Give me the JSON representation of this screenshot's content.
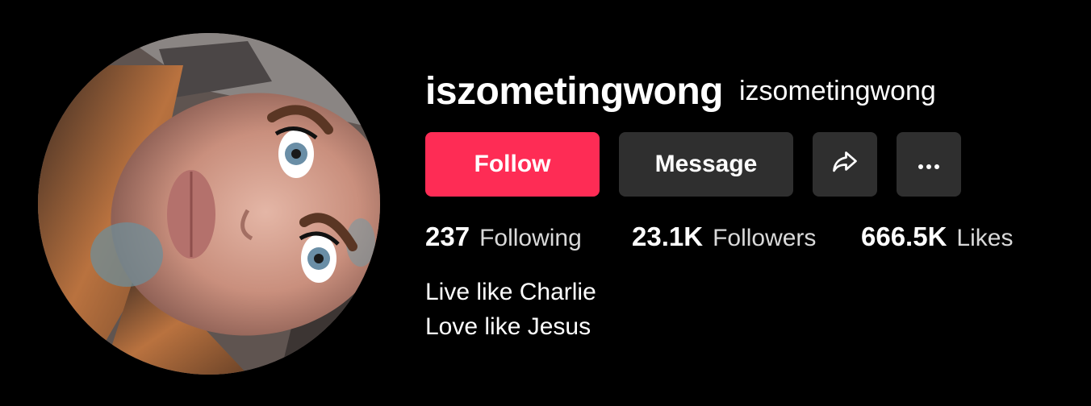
{
  "profile": {
    "username": "iszometingwong",
    "nickname": "izsometingwong",
    "avatar_alt": "profile-photo"
  },
  "actions": {
    "follow_label": "Follow",
    "message_label": "Message",
    "share_icon": "share-arrow-icon",
    "more_icon": "more-dots-icon",
    "more_glyph": "···"
  },
  "stats": {
    "following": {
      "count": "237",
      "label": "Following"
    },
    "followers": {
      "count": "23.1K",
      "label": "Followers"
    },
    "likes": {
      "count": "666.5K",
      "label": "Likes"
    }
  },
  "bio": {
    "line1": "Live like Charlie",
    "line2": "Love like Jesus"
  },
  "colors": {
    "background": "#000000",
    "follow_button": "#fe2c55",
    "secondary_button": "#2f2f2f",
    "text": "#ffffff"
  }
}
